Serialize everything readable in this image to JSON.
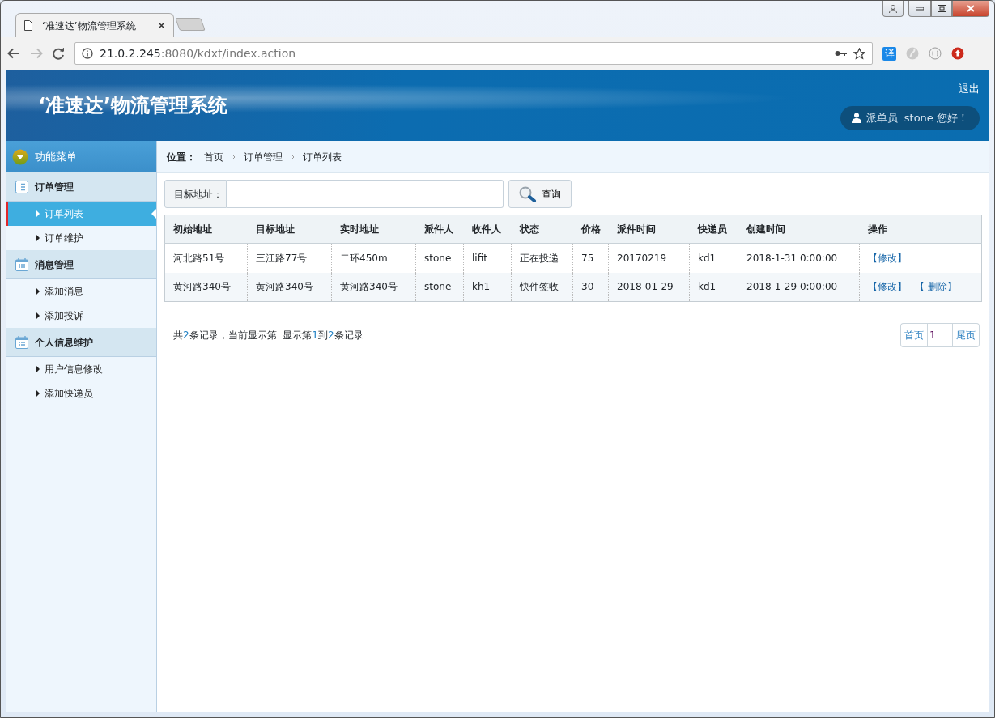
{
  "browser": {
    "tab_title": "‘准速达’物流管理系统",
    "url_host": "21.0.2.245",
    "url_rest": ":8080/kdxt/index.action",
    "translate_glyph": "译"
  },
  "header": {
    "title": "‘准速达’物流管理系统",
    "logout": "退出",
    "greeting": "派单员  stone 您好！"
  },
  "sidebar": {
    "heading": "功能菜单",
    "groups": [
      {
        "label": "订单管理",
        "items": [
          {
            "label": "订单列表",
            "selected": true
          },
          {
            "label": "订单维护",
            "selected": false
          }
        ]
      },
      {
        "label": "消息管理",
        "items": [
          {
            "label": "添加消息",
            "selected": false
          },
          {
            "label": "添加投诉",
            "selected": false
          }
        ]
      },
      {
        "label": "个人信息维护",
        "items": [
          {
            "label": "用户信息修改",
            "selected": false
          },
          {
            "label": "添加快递员",
            "selected": false
          }
        ]
      }
    ]
  },
  "breadcrumb": {
    "label": "位置：",
    "items": [
      "首页",
      "订单管理",
      "订单列表"
    ]
  },
  "search": {
    "label": "目标地址：",
    "button": "查询"
  },
  "table": {
    "columns": [
      "初始地址",
      "目标地址",
      "实时地址",
      "派件人",
      "收件人",
      "状态",
      "价格",
      "派件时间",
      "快递员",
      "创建时间",
      "操作"
    ],
    "rows": [
      {
        "cells": [
          "河北路51号",
          "三江路77号",
          "二环450m",
          "stone",
          "lifit",
          "正在投递",
          "75",
          "20170219",
          "kd1",
          "2018-1-31 0:00:00"
        ],
        "actions": [
          "【修改】"
        ]
      },
      {
        "cells": [
          "黄河路340号",
          "黄河路340号",
          "黄河路340号",
          "stone",
          "kh1",
          "快件签收",
          "30",
          "2018-01-29",
          "kd1",
          "2018-1-29 0:00:00"
        ],
        "actions": [
          "【修改】",
          "【 删除】"
        ]
      }
    ]
  },
  "summary": [
    {
      "text": "共",
      "number": false
    },
    {
      "text": "2",
      "number": true
    },
    {
      "text": "条记录，当前显示第  显示第",
      "number": false
    },
    {
      "text": "1",
      "number": true
    },
    {
      "text": "到",
      "number": false
    },
    {
      "text": "2",
      "number": true
    },
    {
      "text": "条记录",
      "number": false
    }
  ],
  "pager": {
    "first": "首页",
    "page": "1",
    "last": "尾页"
  }
}
